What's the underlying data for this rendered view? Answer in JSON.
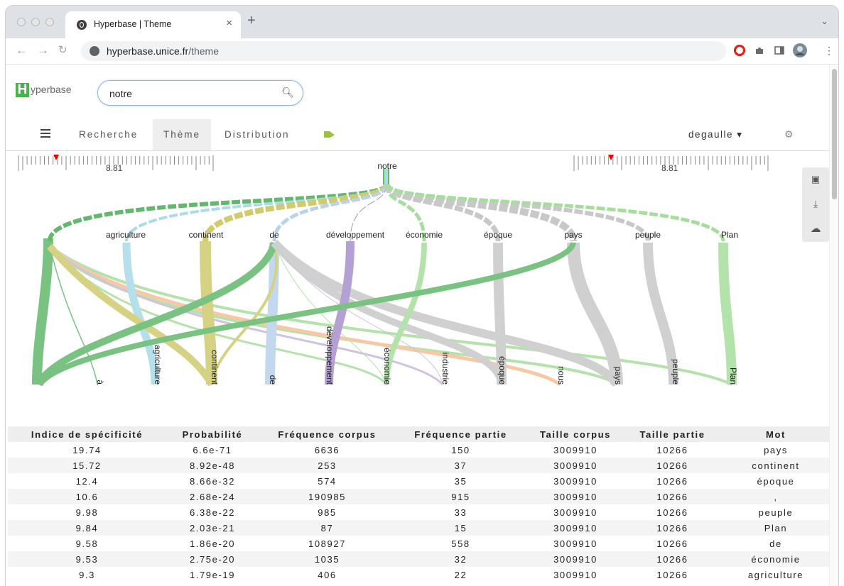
{
  "browser": {
    "tab_title": "Hyperbase | Theme",
    "tab_close": "×",
    "new_tab": "+",
    "url_host": "hyperbase.unice.fr",
    "url_path": "/theme"
  },
  "app": {
    "logo_letter": "H",
    "logo_rest": "yperbase",
    "search_value": "notre",
    "menu": {
      "recherche": "Recherche",
      "theme": "Thème",
      "distribution": "Distribution"
    },
    "corpus": "degaulle ▾"
  },
  "sliders": {
    "left_value": "8.81",
    "right_value": "8.81"
  },
  "graph": {
    "root": "notre",
    "top_words": [
      "agriculture",
      "continent",
      "de",
      "développement",
      "économie",
      "époque",
      "pays",
      "peuple",
      "Plan"
    ],
    "bottom_words": [
      "à",
      "agriculture",
      "continent",
      "de",
      "développement",
      "économie",
      "industrie",
      "époque",
      "nous",
      "pays",
      "peuple",
      "Plan"
    ]
  },
  "table": {
    "headers": [
      "Indice de spécificité",
      "Probabilité",
      "Fréquence corpus",
      "Fréquence partie",
      "Taille corpus",
      "Taille partie",
      "Mot"
    ],
    "rows": [
      [
        "19.74",
        "6.6e-71",
        "6636",
        "150",
        "3009910",
        "10266",
        "pays"
      ],
      [
        "15.72",
        "8.92e-48",
        "253",
        "37",
        "3009910",
        "10266",
        "continent"
      ],
      [
        "12.4",
        "8.66e-32",
        "574",
        "35",
        "3009910",
        "10266",
        "époque"
      ],
      [
        "10.6",
        "2.68e-24",
        "190985",
        "915",
        "3009910",
        "10266",
        ","
      ],
      [
        "9.98",
        "6.38e-22",
        "985",
        "33",
        "3009910",
        "10266",
        "peuple"
      ],
      [
        "9.84",
        "2.03e-21",
        "87",
        "15",
        "3009910",
        "10266",
        "Plan"
      ],
      [
        "9.58",
        "1.86e-20",
        "108927",
        "558",
        "3009910",
        "10266",
        "de"
      ],
      [
        "9.53",
        "2.75e-20",
        "1035",
        "32",
        "3009910",
        "10266",
        "économie"
      ],
      [
        "9.3",
        "1.79e-19",
        "406",
        "22",
        "3009910",
        "10266",
        "agriculture"
      ]
    ]
  },
  "colors": {
    "agriculture": "#a9dbe8",
    "continent": "#cfcb6e",
    "de": "#b9d2ec",
    "developpement": "#a890cc",
    "economie": "#a6dd9c",
    "epoque": "#c8c8c8",
    "pays": "#63b86d",
    "peuple": "#c8c8c8",
    "plan": "#9edd8f",
    "a": "#63b86d",
    "nous": "#f6bf94",
    "industrie": "#cab9da"
  }
}
